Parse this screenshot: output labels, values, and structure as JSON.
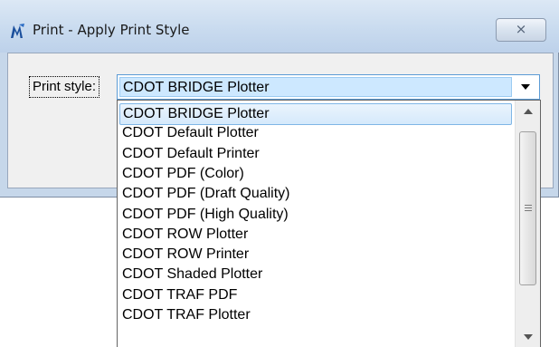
{
  "window": {
    "title": "Print - Apply Print Style",
    "close_glyph": "⨯",
    "icon": "microstation-logo-icon",
    "close_icon": "close-icon"
  },
  "form": {
    "print_style_label": "Print style:",
    "print_style_value": "CDOT BRIDGE Plotter"
  },
  "dropdown": {
    "options": [
      {
        "label": "CDOT BRIDGE Plotter",
        "selected": true
      },
      {
        "label": "CDOT Default Plotter",
        "selected": false
      },
      {
        "label": "CDOT Default Printer",
        "selected": false
      },
      {
        "label": "CDOT PDF (Color)",
        "selected": false
      },
      {
        "label": "CDOT PDF (Draft Quality)",
        "selected": false
      },
      {
        "label": "CDOT PDF (High Quality)",
        "selected": false
      },
      {
        "label": "CDOT ROW Plotter",
        "selected": false
      },
      {
        "label": "CDOT ROW Printer",
        "selected": false
      },
      {
        "label": "CDOT Shaded Plotter",
        "selected": false
      },
      {
        "label": "CDOT TRAF PDF",
        "selected": false
      },
      {
        "label": "CDOT TRAF Plotter",
        "selected": false
      }
    ],
    "scroll_up_icon": "scroll-up-arrow-icon",
    "scroll_down_icon": "scroll-down-arrow-icon"
  },
  "colors": {
    "titlebar": "#c9dbef",
    "selection": "#cde8ff",
    "combo_border": "#5b9bd5"
  }
}
